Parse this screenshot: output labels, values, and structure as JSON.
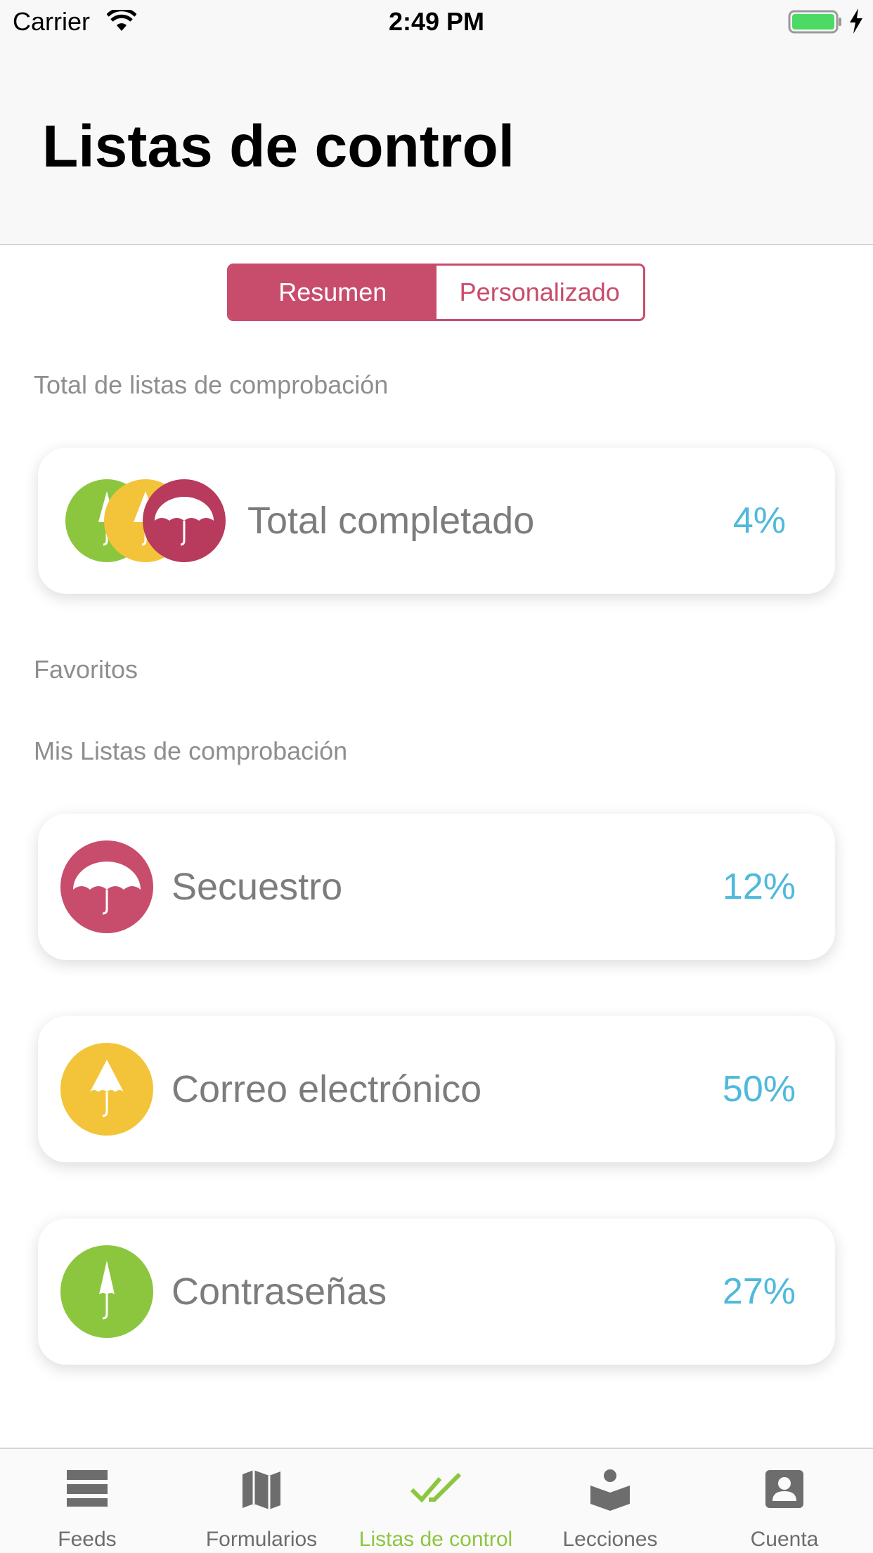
{
  "status_bar": {
    "carrier": "Carrier",
    "time": "2:49 PM"
  },
  "header": {
    "title": "Listas de control"
  },
  "segmented_control": {
    "items": [
      "Resumen",
      "Personalizado"
    ],
    "selected": "Resumen"
  },
  "sections": {
    "total_label": "Total de listas de comprobación",
    "favorites_label": "Favoritos",
    "my_lists_label": "Mis Listas de comprobación"
  },
  "total_card": {
    "label": "Total completado",
    "value": "4%"
  },
  "checklists": [
    {
      "label": "Secuestro",
      "value": "12%",
      "color": "#c84c6c",
      "icon": "umbrella-open-icon"
    },
    {
      "label": "Correo electrónico",
      "value": "50%",
      "color": "#f3c43a",
      "icon": "umbrella-half-icon"
    },
    {
      "label": "Contraseñas",
      "value": "27%",
      "color": "#8cc63f",
      "icon": "umbrella-closed-icon"
    }
  ],
  "tab_bar": {
    "items": [
      {
        "label": "Feeds",
        "icon": "feeds-icon"
      },
      {
        "label": "Formularios",
        "icon": "map-icon"
      },
      {
        "label": "Listas de control",
        "icon": "double-check-icon"
      },
      {
        "label": "Lecciones",
        "icon": "book-reader-icon"
      },
      {
        "label": "Cuenta",
        "icon": "account-icon"
      }
    ],
    "active": "Listas de control"
  },
  "colors": {
    "accent": "#c84c6c",
    "percent": "#4fb9dc",
    "tab_active": "#8cc63f",
    "yellow": "#f3c43a",
    "green": "#8cc63f"
  }
}
